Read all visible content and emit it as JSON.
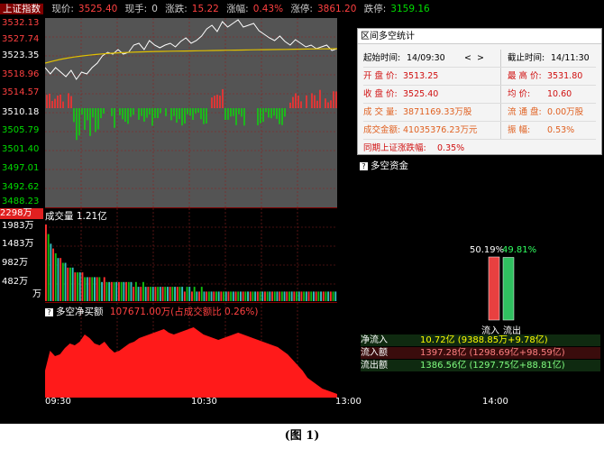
{
  "topbar": {
    "name": "上证指数",
    "price_label": "现价:",
    "price": "3525.40",
    "hand_label": "现手:",
    "hand": "0",
    "change_label": "涨跌:",
    "change": "15.22",
    "pct_label": "涨幅:",
    "pct": "0.43%",
    "limit_up_label": "涨停:",
    "limit_up": "3861.20",
    "limit_down_label": "跌停:",
    "limit_down": "3159.16"
  },
  "price_axis": [
    "3532.13",
    "3527.74",
    "3523.35",
    "3518.96",
    "3514.57",
    "3510.18",
    "3505.79",
    "3501.40",
    "3497.01",
    "3492.62",
    "3488.23"
  ],
  "volume": {
    "title": "成交量 1.21亿",
    "axis": [
      "2298万",
      "1983万",
      "1483万",
      "982万",
      "482万",
      "万"
    ],
    "values": [
      16,
      14,
      12,
      11,
      10,
      9,
      9,
      8,
      8,
      7,
      7,
      7,
      6,
      6,
      6,
      6,
      5,
      5,
      5,
      5,
      5,
      5,
      5,
      4,
      5,
      4,
      4,
      4,
      4,
      4,
      4,
      4,
      4,
      4,
      4,
      4,
      3,
      4,
      3,
      3,
      4,
      3,
      3,
      3,
      3,
      3,
      3,
      3,
      3,
      3,
      3,
      3,
      3,
      3,
      3,
      3,
      3,
      2,
      3,
      3,
      2,
      3,
      2,
      2,
      3,
      2,
      2,
      2,
      2,
      2,
      2,
      2,
      2,
      2,
      2,
      2,
      2,
      2,
      2,
      2,
      2,
      2,
      2,
      2,
      2,
      2,
      2,
      2,
      2,
      2,
      2,
      2,
      2,
      2,
      2,
      2,
      2,
      2,
      2,
      2,
      2,
      2,
      2,
      2,
      2,
      2,
      2,
      2,
      2,
      2,
      2,
      2,
      2,
      2,
      2,
      2,
      2,
      2,
      2,
      2
    ]
  },
  "flow": {
    "title": "多空净买额",
    "value": "107671.00万(占成交额比 0.26%)",
    "values": [
      30,
      52,
      46,
      48,
      55,
      60,
      58,
      62,
      70,
      66,
      60,
      58,
      62,
      55,
      50,
      52,
      56,
      60,
      62,
      66,
      68,
      70,
      72,
      74,
      76,
      72,
      70,
      72,
      74,
      76,
      78,
      74,
      70,
      68,
      66,
      64,
      66,
      68,
      70,
      72,
      70,
      68,
      66,
      64,
      62,
      60,
      58,
      56,
      52,
      48,
      42,
      36,
      30,
      22,
      18,
      14,
      10,
      8,
      6,
      4
    ]
  },
  "time_axis": [
    "09:30",
    "10:30",
    "13:00",
    "14:00"
  ],
  "panel": {
    "title": "区间多空统计",
    "start_label": "起始时间:",
    "start_value": "14/09:30",
    "prev": "<",
    "next": ">",
    "end_label": "截止时间:",
    "end_value": "14/11:30",
    "open_label": "开 盘 价:",
    "open_value": "3513.25",
    "high_label": "最 高 价:",
    "high_value": "3531.80",
    "close_label": "收 盘 价:",
    "close_value": "3525.40",
    "avg_label": "均    价:",
    "avg_value": "10.60",
    "vol_label": "成 交 量:",
    "vol_value": "3871169.33万股",
    "float_label": "流 通 盘:",
    "float_value": "0.00万股",
    "amount_label": "成交金额:",
    "amount_value": "41035376.23万元",
    "amp_label": "振     幅:",
    "amp_value": "0.53%",
    "period_label": "同期上证涨跌幅:",
    "period_value": "0.35%"
  },
  "funds": {
    "title": "多空资金",
    "in_pct": "50.19%",
    "out_pct": "49.81%",
    "in_label": "流入",
    "out_label": "流出",
    "rows": [
      {
        "label": "净流入",
        "value": "10.72亿 (9388.85万+9.78亿)"
      },
      {
        "label": "流入额",
        "value": "1397.28亿 (1298.69亿+98.59亿)"
      },
      {
        "label": "流出额",
        "value": "1386.56亿 (1297.75亿+88.81亿)"
      }
    ]
  },
  "caption": "(图 1)"
}
